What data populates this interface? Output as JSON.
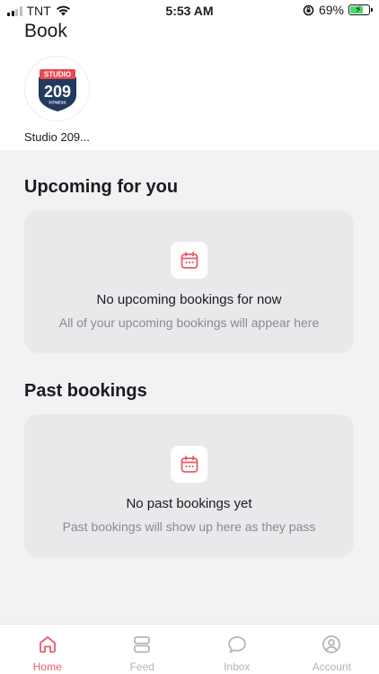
{
  "status_bar": {
    "carrier": "TNT",
    "time": "5:53 AM",
    "battery_percent": "69%",
    "battery_level": 0.69
  },
  "header": {
    "title": "Book"
  },
  "studios": [
    {
      "name": "Studio 209...",
      "logo_top": "STUDIO",
      "logo_number": "209",
      "logo_bottom": "FITNESS"
    }
  ],
  "upcoming": {
    "title": "Upcoming for you",
    "empty_title": "No upcoming bookings for now",
    "empty_subtitle": "All of your upcoming bookings will appear here"
  },
  "past": {
    "title": "Past bookings",
    "empty_title": "No past bookings yet",
    "empty_subtitle": "Past bookings will show up here as they pass"
  },
  "nav": {
    "items": [
      {
        "label": "Home",
        "icon": "home-icon",
        "active": true
      },
      {
        "label": "Feed",
        "icon": "feed-icon",
        "active": false
      },
      {
        "label": "Inbox",
        "icon": "chat-bubble-icon",
        "active": false
      },
      {
        "label": "Account",
        "icon": "user-circle-icon",
        "active": false
      }
    ]
  },
  "colors": {
    "accent": "#e85c6a",
    "logo_navy": "#233a5e",
    "logo_red": "#e8484f",
    "background": "#f2f2f4",
    "card": "#e9e9ec"
  }
}
